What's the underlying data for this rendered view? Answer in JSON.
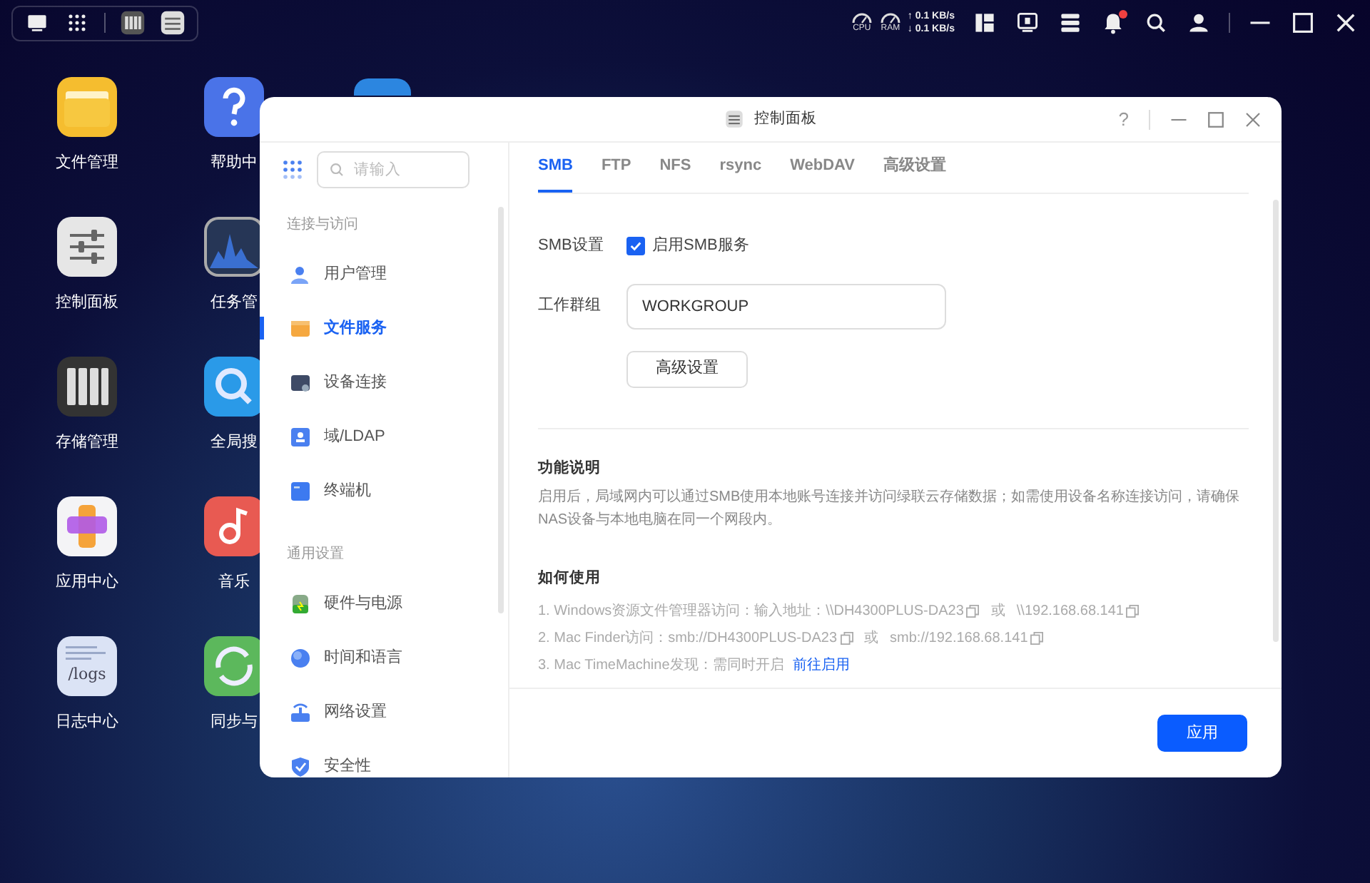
{
  "taskbar": {
    "left_icons": [
      {
        "kind": "monitor"
      },
      {
        "kind": "apps"
      },
      {
        "kind": "storage"
      },
      {
        "kind": "control"
      }
    ],
    "gauges": [
      "CPU",
      "RAM"
    ],
    "speeds": [
      {
        "arrow": "↑",
        "text": "0.1 KB/s"
      },
      {
        "arrow": "↓",
        "text": "0.1 KB/s"
      }
    ],
    "right_icons": [
      {
        "kind": "layout"
      },
      {
        "kind": "screen"
      },
      {
        "kind": "servers"
      },
      {
        "kind": "bell",
        "badge": true
      },
      {
        "kind": "search"
      },
      {
        "kind": "user"
      }
    ]
  },
  "desktop": {
    "icons": [
      {
        "label": "文件管理",
        "kind": "files"
      },
      {
        "label": "帮助中",
        "kind": "help"
      },
      {
        "label": "控制面板",
        "kind": "sliders"
      },
      {
        "label": "任务管",
        "kind": "monitor"
      },
      {
        "label": "存储管理",
        "kind": "drives"
      },
      {
        "label": "全局搜",
        "kind": "search"
      },
      {
        "label": "应用中心",
        "kind": "appcenter"
      },
      {
        "label": "音乐",
        "kind": "music"
      },
      {
        "label": "日志中心",
        "kind": "logs",
        "icon_text": "/logs"
      },
      {
        "label": "同步与",
        "kind": "sync"
      }
    ]
  },
  "window": {
    "title": "控制面板",
    "help": "?",
    "sidebar": {
      "search": {
        "placeholder": "请输入"
      },
      "groups": [
        {
          "heading": "连接与访问",
          "items": [
            {
              "label": "用户管理",
              "kind": "user",
              "selected": false
            },
            {
              "label": "文件服务",
              "kind": "folder",
              "selected": true
            },
            {
              "label": "设备连接",
              "kind": "device",
              "selected": false
            },
            {
              "label": "域/LDAP",
              "kind": "ldap",
              "selected": false
            },
            {
              "label": "终端机",
              "kind": "terminal",
              "selected": false
            }
          ]
        },
        {
          "heading": "通用设置",
          "items": [
            {
              "label": "硬件与电源",
              "kind": "hardware",
              "selected": false
            },
            {
              "label": "时间和语言",
              "kind": "globe",
              "selected": false
            },
            {
              "label": "网络设置",
              "kind": "network",
              "selected": false
            },
            {
              "label": "安全性",
              "kind": "shield",
              "selected": false
            }
          ]
        }
      ]
    },
    "tabs": [
      {
        "label": "SMB",
        "selected": true
      },
      {
        "label": "FTP",
        "selected": false
      },
      {
        "label": "NFS",
        "selected": false
      },
      {
        "label": "rsync",
        "selected": false
      },
      {
        "label": "WebDAV",
        "selected": false
      },
      {
        "label": "高级设置",
        "selected": false
      }
    ],
    "form": {
      "smb_label": "SMB设置",
      "enable": {
        "label": "启用SMB服务",
        "checked": true
      },
      "workgroup_label": "工作群组",
      "workgroup_value": "WORKGROUP",
      "advanced_button": "高级设置"
    },
    "description": {
      "title": "功能说明",
      "text": "启用后，局域网内可以通过SMB使用本地账号连接并访问绿联云存储数据；如需使用设备名称连接访问，请确保NAS设备与本地电脑在同一个网段内。"
    },
    "usage": {
      "title": "如何使用",
      "steps": [
        [
          {
            "kind": "text",
            "text": "1. Windows资源文件管理器访问：输入地址：\\\\DH4300PLUS-DA23"
          },
          {
            "kind": "copy"
          },
          {
            "kind": "text",
            "text": "或"
          },
          {
            "kind": "text",
            "text": "\\\\192.168.68.141"
          },
          {
            "kind": "copy"
          }
        ],
        [
          {
            "kind": "text",
            "text": "2. Mac Finder访问：smb://DH4300PLUS-DA23"
          },
          {
            "kind": "copy"
          },
          {
            "kind": "text",
            "text": "或"
          },
          {
            "kind": "text",
            "text": "smb://192.168.68.141"
          },
          {
            "kind": "copy"
          }
        ],
        [
          {
            "kind": "text",
            "text": "3. Mac TimeMachine发现：需同时开启"
          },
          {
            "kind": "link",
            "text": "前往启用"
          }
        ]
      ]
    },
    "apply_button": "应用"
  }
}
